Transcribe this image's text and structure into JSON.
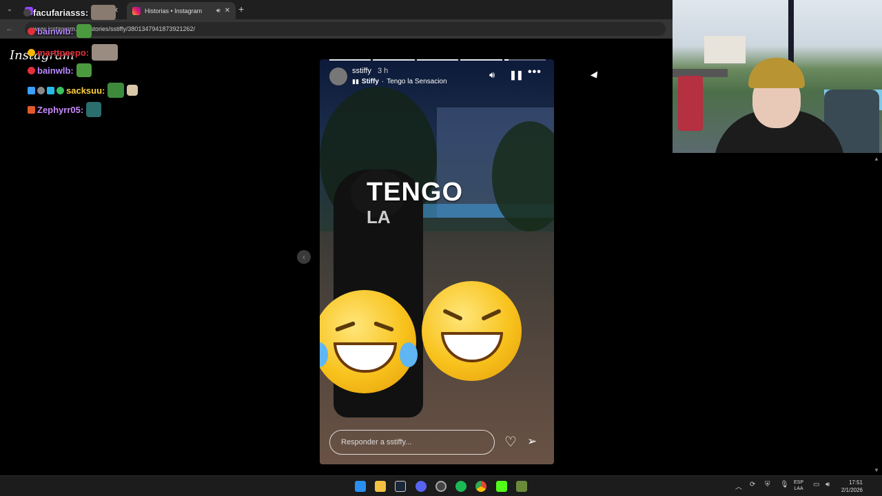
{
  "browser": {
    "tabs": [
      {
        "label": "facufariasss:"
      },
      {
        "label": "Historias • Instagram"
      }
    ],
    "new_tab": "+",
    "url": "www.instagram.com/stories/sstiffy/3801347941873921262/"
  },
  "page": {
    "logo": "Instagram"
  },
  "chat": {
    "messages": [
      {
        "user": "facufariasss:",
        "color": "#f2f2f2"
      },
      {
        "user": "bainwlb:",
        "color": "#b78bff"
      },
      {
        "user": "marttpeepo:",
        "color": "#e1303a"
      },
      {
        "user": "bainwlb:",
        "color": "#b78bff"
      },
      {
        "user": "sacksuu:",
        "color": "#ffd23a"
      },
      {
        "user": "Zephyrr05:",
        "color": "#c88bff"
      }
    ]
  },
  "story": {
    "username": "sstiffy",
    "time": "3 h",
    "song_artist": "Stiffy",
    "song_separator": " · ",
    "song_title": "Tengo la Sensacion",
    "overlay_text_line1": "TENGO",
    "overlay_text_line2": "LA",
    "reply_placeholder": "Responder a sstiffy...",
    "segments": 5,
    "current_segment": 5,
    "current_segment_progress": 0.1
  },
  "taskbar": {
    "language": "ESP",
    "layout": "LAA",
    "time": "17:51",
    "date": "2/1/2026"
  },
  "colors": {
    "accent_ig": "#e1306c",
    "background": "#000000"
  }
}
